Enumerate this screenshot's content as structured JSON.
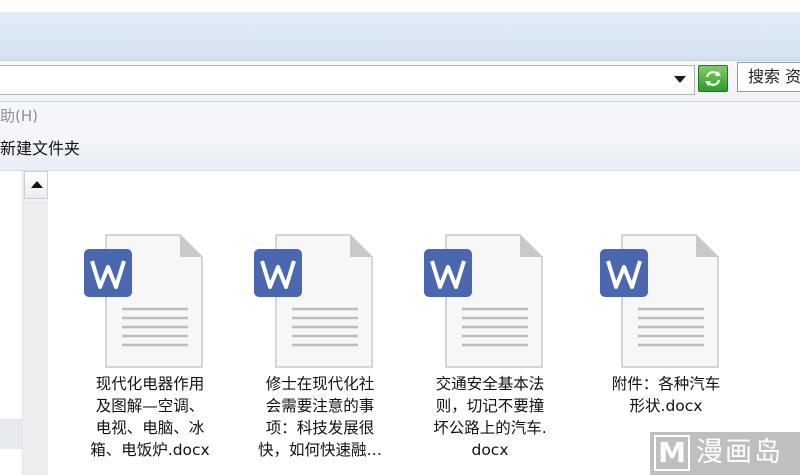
{
  "menubar": {
    "help": "助(H)"
  },
  "toolbar": {
    "new_folder": "新建文件夹"
  },
  "search": {
    "label": "搜索 资"
  },
  "colors": {
    "doc_icon_blue": "#4a67b0",
    "page_fold": "#c9c9c9"
  },
  "files": [
    {
      "name": "现代化电器作用及图解—空调、电视、电脑、冰箱、电饭炉.docx",
      "lines": [
        "现代化电器作用",
        "及图解—空调、",
        "电视、电脑、冰",
        "箱、电饭炉.docx"
      ]
    },
    {
      "name": "修士在现代化社会需要注意的事项：科技发展很快，如何快速融…",
      "lines": [
        "修士在现代化社",
        "会需要注意的事",
        "项：科技发展很",
        "快，如何快速融…"
      ]
    },
    {
      "name": "交通安全基本法则，切记不要撞坏公路上的汽车.docx",
      "lines": [
        "交通安全基本法",
        "则，切记不要撞",
        "坏公路上的汽车.",
        "docx"
      ]
    },
    {
      "name": "附件：各种汽车形状.docx",
      "lines": [
        "附件：各种汽车",
        "形状.docx"
      ]
    }
  ],
  "watermark": {
    "logo": "M",
    "text": "漫画岛"
  }
}
